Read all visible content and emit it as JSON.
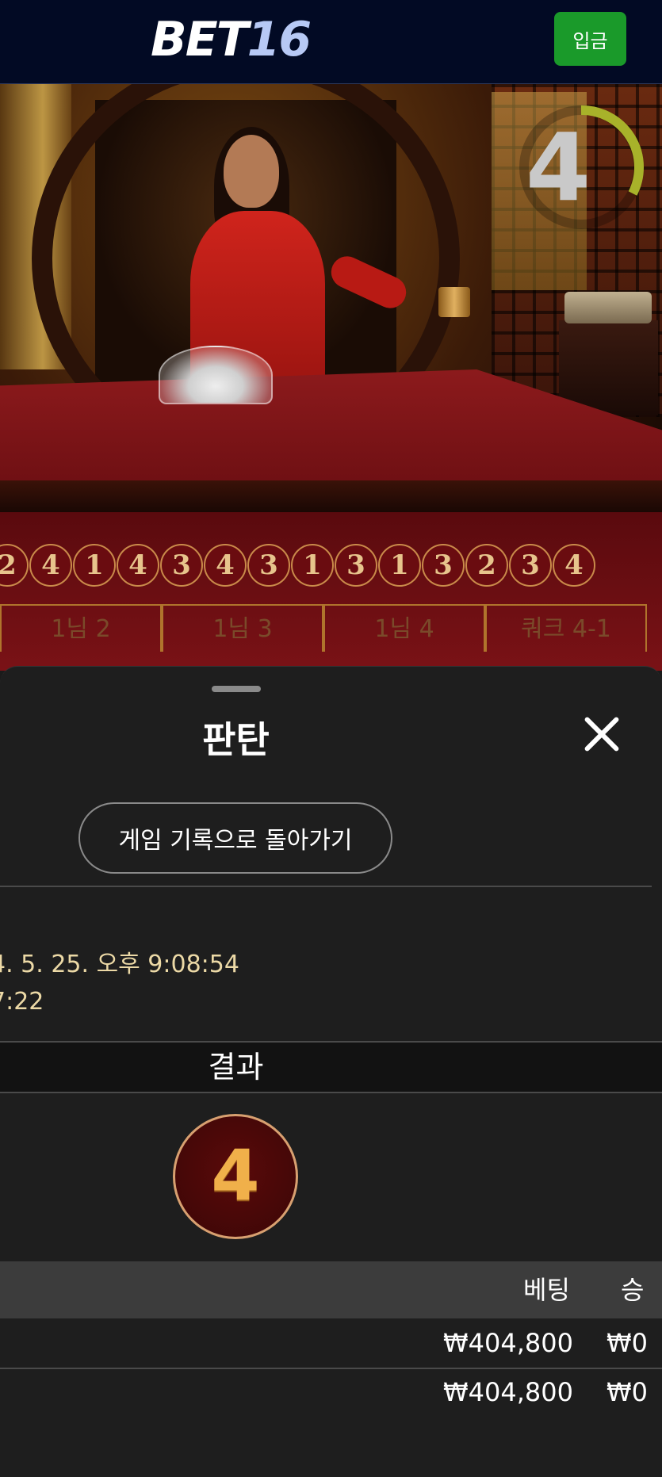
{
  "header": {
    "logo_part1": "BET",
    "logo_part2": "16",
    "deposit_label": "입금",
    "deposit_color": "#1a9a2a"
  },
  "video": {
    "timer_value": "4",
    "history": [
      "2",
      "4",
      "1",
      "4",
      "3",
      "4",
      "3",
      "1",
      "3",
      "1",
      "3",
      "2",
      "3",
      "4"
    ],
    "bet_spots": [
      "1님 2",
      "1님 3",
      "1님 4",
      "쿼크 4-1"
    ]
  },
  "sheet": {
    "title": "판탄",
    "close_icon": "close-icon",
    "back_button_label": "게임 기록으로 돌아가기",
    "round_datetime": "4. 5. 25. 오후 9:08:54",
    "round_time_fragment": "7:22",
    "result_label": "결과",
    "result_value": "4",
    "table": {
      "headers": {
        "bet": "베팅",
        "win": "승"
      },
      "rows": [
        {
          "bet": "₩404,800",
          "win": "₩0"
        },
        {
          "bet": "₩404,800",
          "win": "₩0"
        }
      ]
    }
  }
}
